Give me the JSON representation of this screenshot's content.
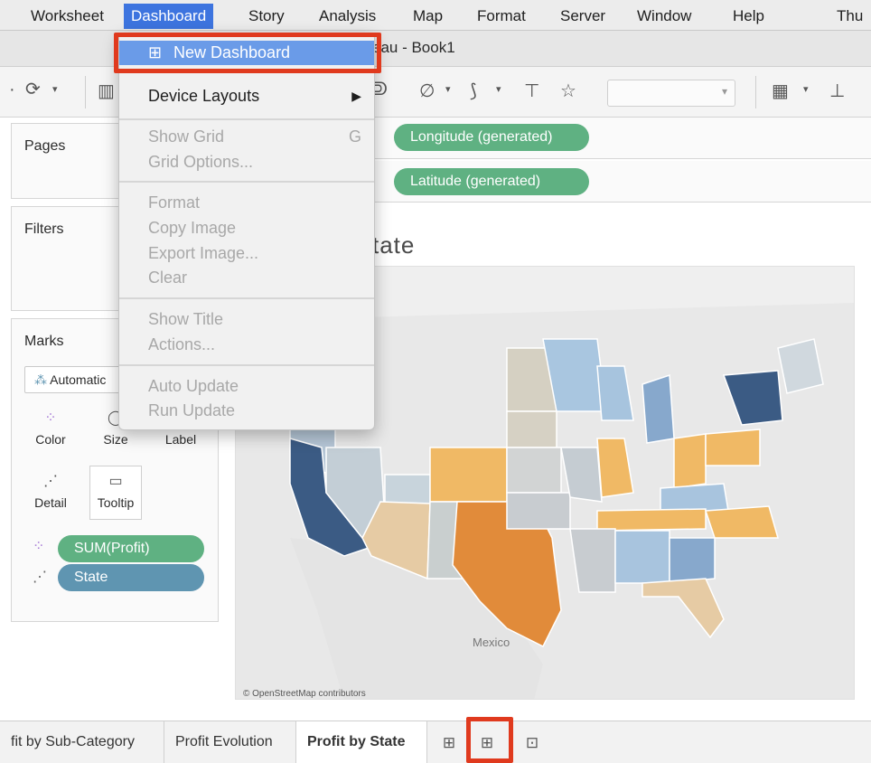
{
  "menubar": {
    "items": [
      "Worksheet",
      "Dashboard",
      "Story",
      "Analysis",
      "Map",
      "Format",
      "Server",
      "Window",
      "Help",
      "Thu"
    ]
  },
  "titlebar": {
    "title": "eau - Book1"
  },
  "shelves": {
    "pages_label": "Pages",
    "columns_pill": "Longitude (generated)",
    "rows_pill": "Latitude (generated)"
  },
  "panels": {
    "filters_label": "Filters",
    "marks_label": "Marks",
    "marks_type": "Automatic",
    "cards": {
      "color": "Color",
      "size": "Size",
      "label": "Label",
      "detail": "Detail",
      "tooltip": "Tooltip"
    },
    "pills": {
      "profit": "SUM(Profit)",
      "state": "State"
    }
  },
  "view": {
    "title_fragment": "tate",
    "mexico_label": "Mexico",
    "attribution": "© OpenStreetMap contributors"
  },
  "tabs": [
    "fit by Sub-Category",
    "Profit Evolution",
    "Profit by State"
  ],
  "dropdown": {
    "new_dashboard": "New Dashboard",
    "device_layouts": "Device Layouts",
    "show_grid": "Show Grid",
    "show_grid_shortcut": "G",
    "grid_options": "Grid Options...",
    "format": "Format",
    "copy_image": "Copy Image",
    "export_image": "Export Image...",
    "clear": "Clear",
    "show_title": "Show Title",
    "actions": "Actions...",
    "auto_update": "Auto Update",
    "run_update": "Run Update"
  },
  "colors": {
    "menu_active": "#3d74df",
    "dropdown_highlight": "#6a9be8",
    "callout_red": "#e03a1e",
    "pill_green": "#5fb182",
    "pill_blue": "#5f95b1",
    "profit_high": "#3b5b84",
    "profit_low": "#e18b3a"
  }
}
